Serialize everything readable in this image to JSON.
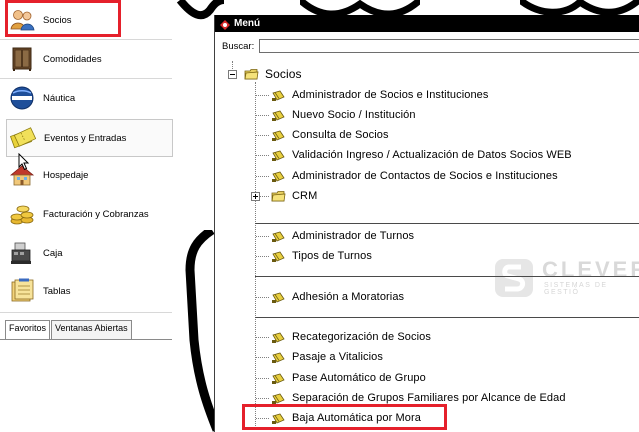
{
  "left_nav": {
    "items": [
      {
        "label": "Socios",
        "icon": "users-icon"
      },
      {
        "label": "Comodidades",
        "icon": "cabinet-icon"
      },
      {
        "label": "Náutica",
        "icon": "nautica-icon"
      },
      {
        "label": "Eventos y Entradas",
        "icon": "tickets-icon"
      },
      {
        "label": "Hospedaje",
        "icon": "house-icon"
      },
      {
        "label": "Facturación y Cobranzas",
        "icon": "coins-icon"
      },
      {
        "label": "Caja",
        "icon": "cash-register-icon"
      },
      {
        "label": "Tablas",
        "icon": "tables-icon"
      }
    ],
    "selected": "Eventos y Entradas",
    "tabs": [
      {
        "label": "Favoritos"
      },
      {
        "label": "Ventanas Abiertas"
      }
    ]
  },
  "menu_window": {
    "title": "Menú",
    "search_label": "Buscar:",
    "search_value": "",
    "tree": {
      "root": "Socios",
      "items": [
        "Administrador de Socios e Instituciones",
        "Nuevo Socio / Institución",
        "Consulta de Socios",
        "Validación Ingreso / Actualización de Datos Socios WEB",
        "Administrador de Contactos de Socios e Instituciones",
        "CRM",
        "Administrador de Turnos",
        "Tipos de Turnos",
        "Adhesión a Moratorias",
        "Recategorización de Socios",
        "Pasaje a Vitalicios",
        "Pase Automático de Grupo",
        "Separación de Grupos Familiares por Alcance de Edad",
        "Baja Automática por Mora"
      ]
    }
  },
  "watermark": {
    "brand": "CLEVER",
    "tagline": "SISTEMAS DE GESTIÓ"
  },
  "colors": {
    "highlight": "#e5202b",
    "titlebar": "#000000",
    "watermark": "#d9d9d9"
  }
}
